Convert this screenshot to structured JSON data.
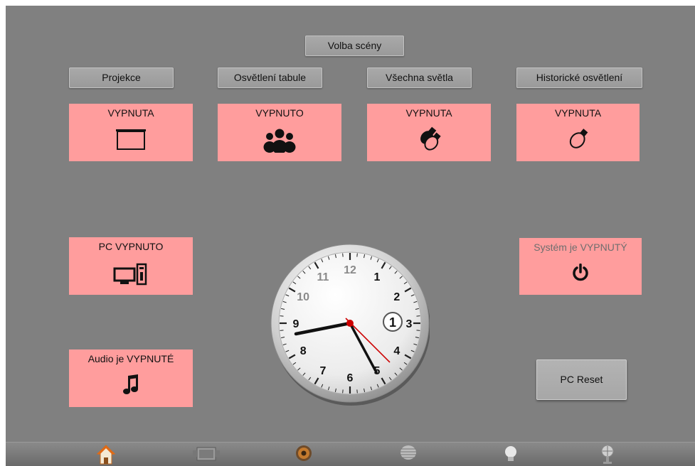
{
  "scene": {
    "title": "Volba scény"
  },
  "columns": [
    {
      "header": "Projekce",
      "status": "VYPNUTA"
    },
    {
      "header": "Osvětlení tabule",
      "status": "VYPNUTO"
    },
    {
      "header": "Všechna světla",
      "status": "VYPNUTA"
    },
    {
      "header": "Historické osvětlení",
      "status": "VYPNUTA"
    }
  ],
  "pc": {
    "status": "PC VYPNUTO"
  },
  "audio": {
    "status": "Audio je VYPNUTÉ"
  },
  "system": {
    "status": "Systém je VYPNUTÝ"
  },
  "pc_reset": {
    "label": "PC Reset"
  },
  "clock": {
    "numbers": [
      "12",
      "1",
      "2",
      "3",
      "4",
      "5",
      "6",
      "7",
      "8",
      "9",
      "10",
      "11"
    ],
    "date_badge": "1"
  },
  "colors": {
    "panel_bg": "#808080",
    "tile_off": "#ff9d9d",
    "second_hand": "#cc0000"
  },
  "dock": {
    "icons": [
      "home-icon",
      "projector-icon",
      "audio-icon",
      "blinds-icon",
      "bulb-icon",
      "fan-icon"
    ]
  }
}
